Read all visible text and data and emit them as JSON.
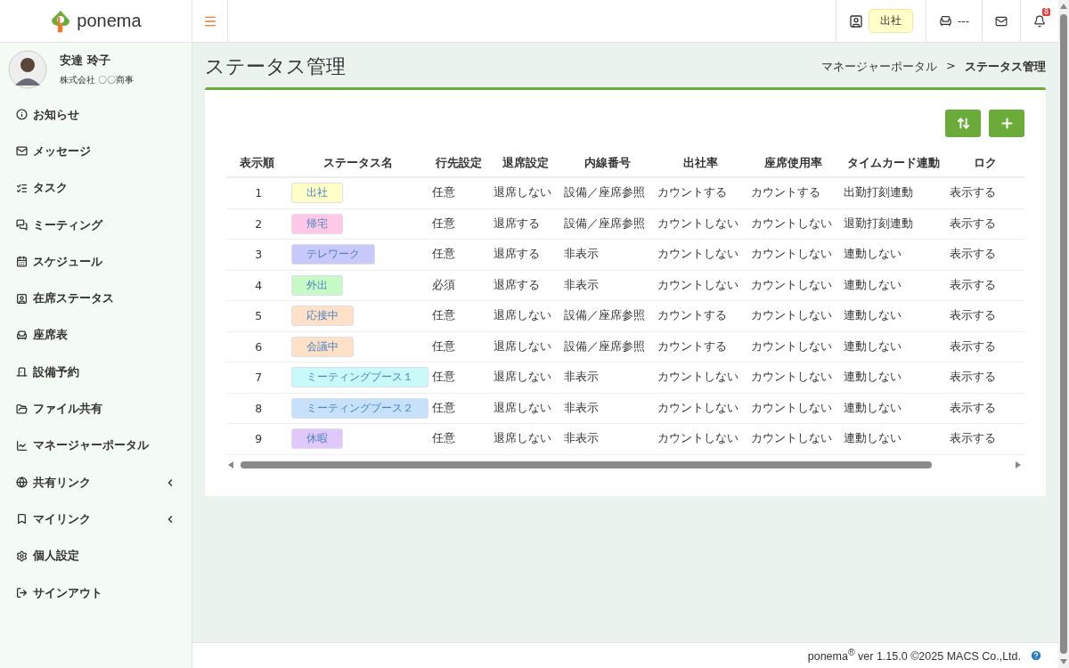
{
  "brand": {
    "name": "ponema"
  },
  "header": {
    "status_label": "出社",
    "seat_label": "---",
    "notification_count": "8"
  },
  "user": {
    "name": "安達 玲子",
    "company": "株式会社 〇〇商事"
  },
  "sidebar": {
    "items": [
      {
        "label": "お知らせ",
        "has_submenu": false
      },
      {
        "label": "メッセージ",
        "has_submenu": false
      },
      {
        "label": "タスク",
        "has_submenu": false
      },
      {
        "label": "ミーティング",
        "has_submenu": false
      },
      {
        "label": "スケジュール",
        "has_submenu": false
      },
      {
        "label": "在席ステータス",
        "has_submenu": false
      },
      {
        "label": "座席表",
        "has_submenu": false
      },
      {
        "label": "設備予約",
        "has_submenu": false
      },
      {
        "label": "ファイル共有",
        "has_submenu": false
      },
      {
        "label": "マネージャーポータル",
        "has_submenu": false
      },
      {
        "label": "共有リンク",
        "has_submenu": true
      },
      {
        "label": "マイリンク",
        "has_submenu": true
      },
      {
        "label": "個人設定",
        "has_submenu": false
      },
      {
        "label": "サインアウト",
        "has_submenu": false
      }
    ]
  },
  "page": {
    "title": "ステータス管理",
    "breadcrumb": [
      "マネージャーポータル",
      "ステータス管理"
    ],
    "breadcrumb_separator": ">"
  },
  "table": {
    "columns": [
      "表示順",
      "ステータス名",
      "行先設定",
      "退席設定",
      "内線番号",
      "出社率",
      "座席使用率",
      "タイムカード連動",
      "ロク"
    ],
    "rows": [
      {
        "order": "1",
        "status": "出社",
        "color": "#ffffc8",
        "destination": "任意",
        "away": "退席しない",
        "extension": "設備／座席参照",
        "attendance": "カウントする",
        "seat_usage": "カウントする",
        "timecard": "出勤打刻連動",
        "column_9": "表示する"
      },
      {
        "order": "2",
        "status": "帰宅",
        "color": "#ffc8e6",
        "destination": "任意",
        "away": "退席する",
        "extension": "設備／座席参照",
        "attendance": "カウントしない",
        "seat_usage": "カウントしない",
        "timecard": "退勤打刻連動",
        "column_9": "表示する"
      },
      {
        "order": "3",
        "status": "テレワーク",
        "color": "#c8c8fa",
        "destination": "任意",
        "away": "退席する",
        "extension": "非表示",
        "attendance": "カウントしない",
        "seat_usage": "カウントしない",
        "timecard": "連動しない",
        "column_9": "表示する"
      },
      {
        "order": "4",
        "status": "外出",
        "color": "#c8fac8",
        "destination": "必須",
        "away": "退席する",
        "extension": "非表示",
        "attendance": "カウントしない",
        "seat_usage": "カウントしない",
        "timecard": "連動しない",
        "column_9": "表示する"
      },
      {
        "order": "5",
        "status": "応接中",
        "color": "#ffe1c8",
        "destination": "任意",
        "away": "退席しない",
        "extension": "設備／座席参照",
        "attendance": "カウントする",
        "seat_usage": "カウントしない",
        "timecard": "連動しない",
        "column_9": "表示する"
      },
      {
        "order": "6",
        "status": "会議中",
        "color": "#ffe1c8",
        "destination": "任意",
        "away": "退席しない",
        "extension": "設備／座席参照",
        "attendance": "カウントする",
        "seat_usage": "カウントしない",
        "timecard": "連動しない",
        "column_9": "表示する"
      },
      {
        "order": "7",
        "status": "ミーティングブース１",
        "color": "#c8fafa",
        "destination": "任意",
        "away": "退席しない",
        "extension": "非表示",
        "attendance": "カウントしない",
        "seat_usage": "カウントしない",
        "timecard": "連動しない",
        "column_9": "表示する"
      },
      {
        "order": "8",
        "status": "ミーティングブース２",
        "color": "#c8e1fa",
        "destination": "任意",
        "away": "退席しない",
        "extension": "非表示",
        "attendance": "カウントしない",
        "seat_usage": "カウントしない",
        "timecard": "連動しない",
        "column_9": "表示する"
      },
      {
        "order": "9",
        "status": "休暇",
        "color": "#e1c8fa",
        "destination": "任意",
        "away": "退席しない",
        "extension": "非表示",
        "attendance": "カウントしない",
        "seat_usage": "カウントしない",
        "timecard": "連動しない",
        "column_9": "表示する"
      }
    ]
  },
  "footer": {
    "text": "ponema$^{®}$ ver 1.15.0 ©2025 MACS Co.,Ltd."
  }
}
